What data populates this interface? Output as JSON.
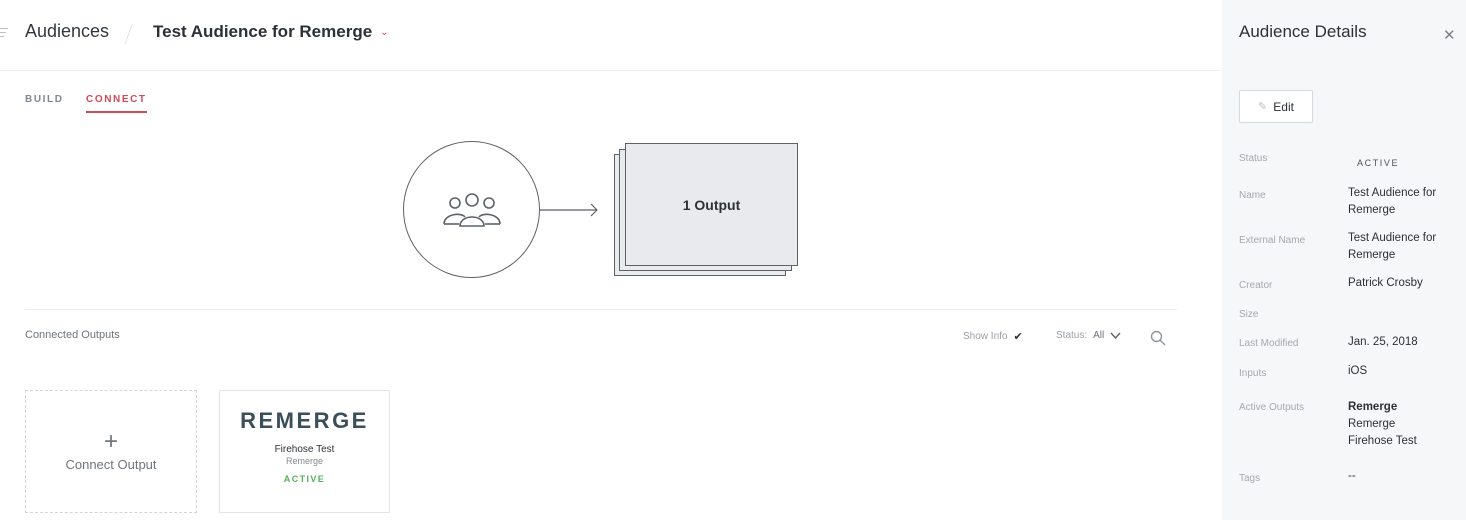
{
  "header": {
    "breadcrumb_root": "Audiences",
    "audience_name": "Test Audience for Remerge"
  },
  "tabs": [
    {
      "label": "BUILD",
      "active": false
    },
    {
      "label": "CONNECT",
      "active": true
    }
  ],
  "diagram": {
    "audience_icon": "users-group-icon",
    "output_stack_label": "1 Output"
  },
  "outputs_section": {
    "title": "Connected Outputs",
    "show_info_label": "Show Info",
    "show_info_checked": true,
    "status_filter_label": "Status:",
    "status_filter_value": "All"
  },
  "connect_card": {
    "label": "Connect Output"
  },
  "output_cards": [
    {
      "logo_text": "REMERGE",
      "name": "Firehose Test",
      "provider": "Remerge",
      "status": "ACTIVE"
    }
  ],
  "details": {
    "title": "Audience Details",
    "edit_label": "Edit",
    "rows": {
      "status": {
        "label": "Status",
        "value": "ACTIVE"
      },
      "name": {
        "label": "Name",
        "value": "Test Audience for Remerge"
      },
      "external_name": {
        "label": "External Name",
        "value": "Test Audience for Remerge"
      },
      "creator": {
        "label": "Creator",
        "value": "Patrick Crosby"
      },
      "size": {
        "label": "Size",
        "value": ""
      },
      "last_modified": {
        "label": "Last Modified",
        "value": "Jan. 25, 2018"
      },
      "inputs": {
        "label": "Inputs",
        "value": "iOS"
      },
      "active_outputs": {
        "label": "Active Outputs",
        "title": "Remerge",
        "line1": "Remerge",
        "line2": "Firehose Test"
      },
      "tags": {
        "label": "Tags",
        "value": "--"
      }
    }
  },
  "colors": {
    "accent": "#d04a5a",
    "active_green": "#53b25b",
    "panel_bg": "#f6f7f9",
    "stack_fill": "#e8eaee"
  }
}
